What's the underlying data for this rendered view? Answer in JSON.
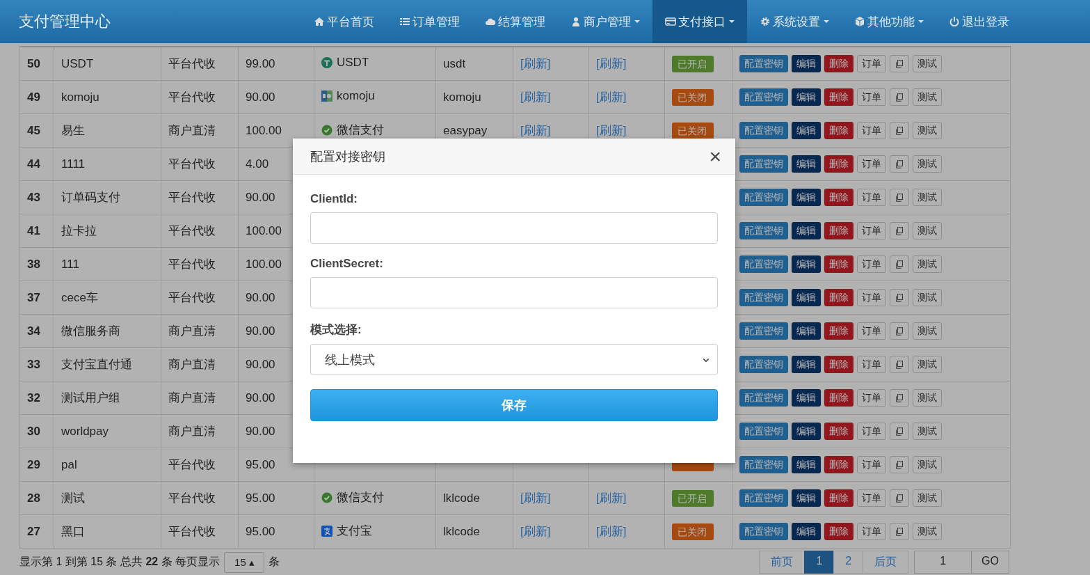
{
  "navbar": {
    "brand": "支付管理中心",
    "items": [
      {
        "kind": "home",
        "label": "平台首页",
        "dropdown": false,
        "selected": false
      },
      {
        "kind": "list",
        "label": "订单管理",
        "dropdown": false,
        "selected": false
      },
      {
        "kind": "cloud",
        "label": "结算管理",
        "dropdown": false,
        "selected": false
      },
      {
        "kind": "user",
        "label": "商户管理",
        "dropdown": true,
        "selected": false
      },
      {
        "kind": "card",
        "label": "支付接口",
        "dropdown": true,
        "selected": true
      },
      {
        "kind": "gear",
        "label": "系统设置",
        "dropdown": true,
        "selected": false
      },
      {
        "kind": "cube",
        "label": "其他功能",
        "dropdown": true,
        "selected": false
      },
      {
        "kind": "power",
        "label": "退出登录",
        "dropdown": false,
        "selected": false
      }
    ]
  },
  "table": {
    "rows": [
      {
        "id": "50",
        "name": "USDT",
        "type": "平台代收",
        "rate": "99.00",
        "channel": {
          "kind": "usdt",
          "label": "USDT"
        },
        "code": "usdt",
        "links": [
          "[刷新]",
          "[刷新]"
        ],
        "status": {
          "on": true,
          "label": "已开启"
        },
        "actions": [
          {
            "kind": "primary",
            "label": "配置密钥"
          },
          {
            "kind": "navy",
            "label": "编辑"
          },
          {
            "kind": "danger",
            "label": "删除"
          },
          {
            "kind": "default",
            "label": "订单"
          },
          {
            "kind": "copy"
          },
          {
            "kind": "default",
            "label": "测试"
          }
        ]
      },
      {
        "id": "49",
        "name": "komoju",
        "type": "平台代收",
        "rate": "90.00",
        "channel": {
          "kind": "komoju",
          "label": "komoju"
        },
        "code": "komoju",
        "links": [
          "[刷新]",
          "[刷新]"
        ],
        "status": {
          "on": false,
          "label": "已关闭"
        },
        "actions": [
          {
            "kind": "primary",
            "label": "配置密钥"
          },
          {
            "kind": "navy",
            "label": "编辑"
          },
          {
            "kind": "danger",
            "label": "删除"
          },
          {
            "kind": "default",
            "label": "订单"
          },
          {
            "kind": "copy"
          },
          {
            "kind": "default",
            "label": "测试"
          }
        ]
      },
      {
        "id": "45",
        "name": "易生",
        "type": "商户直清",
        "rate": "100.00",
        "channel": {
          "kind": "wechat",
          "label": "微信支付"
        },
        "code": "easypay",
        "links": [
          "[刷新]",
          "[刷新]"
        ],
        "status": {
          "on": false,
          "label": "已关闭"
        },
        "actions": [
          {
            "kind": "primary",
            "label": "配置密钥"
          },
          {
            "kind": "navy",
            "label": "编辑"
          },
          {
            "kind": "danger",
            "label": "删除"
          },
          {
            "kind": "default",
            "label": "订单"
          },
          {
            "kind": "copy"
          },
          {
            "kind": "default",
            "label": "测试"
          }
        ]
      },
      {
        "id": "44",
        "name": "1111",
        "type": "平台代收",
        "rate": "4.00",
        "actions": [
          {
            "kind": "primary",
            "label": "配置密钥"
          },
          {
            "kind": "navy",
            "label": "编辑"
          },
          {
            "kind": "danger",
            "label": "删除"
          },
          {
            "kind": "default",
            "label": "订单"
          },
          {
            "kind": "copy"
          },
          {
            "kind": "default",
            "label": "测试"
          }
        ]
      },
      {
        "id": "43",
        "name": "订单码支付",
        "type": "平台代收",
        "rate": "90.00",
        "actions": [
          {
            "kind": "primary",
            "label": "配置密钥"
          },
          {
            "kind": "navy",
            "label": "编辑"
          },
          {
            "kind": "danger",
            "label": "删除"
          },
          {
            "kind": "default",
            "label": "订单"
          },
          {
            "kind": "copy"
          },
          {
            "kind": "default",
            "label": "测试"
          }
        ]
      },
      {
        "id": "41",
        "name": "拉卡拉",
        "type": "平台代收",
        "rate": "100.00",
        "actions": [
          {
            "kind": "primary",
            "label": "配置密钥"
          },
          {
            "kind": "navy",
            "label": "编辑"
          },
          {
            "kind": "danger",
            "label": "删除"
          },
          {
            "kind": "default",
            "label": "订单"
          },
          {
            "kind": "copy"
          },
          {
            "kind": "default",
            "label": "测试"
          }
        ]
      },
      {
        "id": "38",
        "name": "111",
        "type": "平台代收",
        "rate": "100.00",
        "actions": [
          {
            "kind": "primary",
            "label": "配置密钥"
          },
          {
            "kind": "navy",
            "label": "编辑"
          },
          {
            "kind": "danger",
            "label": "删除"
          },
          {
            "kind": "default",
            "label": "订单"
          },
          {
            "kind": "copy"
          },
          {
            "kind": "default",
            "label": "测试"
          }
        ]
      },
      {
        "id": "37",
        "name": "cece车",
        "type": "平台代收",
        "rate": "90.00",
        "actions": [
          {
            "kind": "primary",
            "label": "配置密钥"
          },
          {
            "kind": "navy",
            "label": "编辑"
          },
          {
            "kind": "danger",
            "label": "删除"
          },
          {
            "kind": "default",
            "label": "订单"
          },
          {
            "kind": "copy"
          },
          {
            "kind": "default",
            "label": "测试"
          }
        ]
      },
      {
        "id": "34",
        "name": "微信服务商",
        "type": "商户直清",
        "rate": "90.00",
        "actions": [
          {
            "kind": "primary",
            "label": "配置密钥"
          },
          {
            "kind": "navy",
            "label": "编辑"
          },
          {
            "kind": "danger",
            "label": "删除"
          },
          {
            "kind": "default",
            "label": "订单"
          },
          {
            "kind": "copy"
          },
          {
            "kind": "default",
            "label": "测试"
          }
        ]
      },
      {
        "id": "33",
        "name": "支付宝直付通",
        "type": "商户直清",
        "rate": "90.00",
        "actions": [
          {
            "kind": "primary",
            "label": "配置密钥"
          },
          {
            "kind": "navy",
            "label": "编辑"
          },
          {
            "kind": "danger",
            "label": "删除"
          },
          {
            "kind": "default",
            "label": "订单"
          },
          {
            "kind": "copy"
          },
          {
            "kind": "default",
            "label": "测试"
          }
        ]
      },
      {
        "id": "32",
        "name": "测试用户组",
        "type": "商户直清",
        "rate": "90.00",
        "actions": [
          {
            "kind": "primary",
            "label": "配置密钥"
          },
          {
            "kind": "navy",
            "label": "编辑"
          },
          {
            "kind": "danger",
            "label": "删除"
          },
          {
            "kind": "default",
            "label": "订单"
          },
          {
            "kind": "copy"
          },
          {
            "kind": "default",
            "label": "测试"
          }
        ]
      },
      {
        "id": "30",
        "name": "worldpay",
        "type": "商户直清",
        "rate": "90.00",
        "actions": [
          {
            "kind": "primary",
            "label": "配置密钥"
          },
          {
            "kind": "navy",
            "label": "编辑"
          },
          {
            "kind": "danger",
            "label": "删除"
          },
          {
            "kind": "default",
            "label": "订单"
          },
          {
            "kind": "copy"
          },
          {
            "kind": "default",
            "label": "测试"
          }
        ]
      },
      {
        "id": "29",
        "name": "pal",
        "type": "平台代收",
        "rate": "95.00",
        "status": {
          "on": false
        },
        "actions": [
          {
            "kind": "primary",
            "label": "配置密钥"
          },
          {
            "kind": "navy",
            "label": "编辑"
          },
          {
            "kind": "danger",
            "label": "删除"
          },
          {
            "kind": "default",
            "label": "订单"
          },
          {
            "kind": "copy"
          },
          {
            "kind": "default",
            "label": "测试"
          }
        ]
      },
      {
        "id": "28",
        "name": "测试",
        "type": "平台代收",
        "rate": "95.00",
        "channel": {
          "kind": "wechat",
          "label": "微信支付"
        },
        "code": "lklcode",
        "links": [
          "[刷新]",
          "[刷新]"
        ],
        "status": {
          "on": true,
          "label": "已开启"
        },
        "actions": [
          {
            "kind": "primary",
            "label": "配置密钥"
          },
          {
            "kind": "navy",
            "label": "编辑"
          },
          {
            "kind": "danger",
            "label": "删除"
          },
          {
            "kind": "default",
            "label": "订单"
          },
          {
            "kind": "copy"
          },
          {
            "kind": "default",
            "label": "测试"
          }
        ]
      },
      {
        "id": "27",
        "name": "黑口",
        "type": "平台代收",
        "rate": "95.00",
        "channel": {
          "kind": "alipay",
          "label": "支付宝"
        },
        "code": "lklcode",
        "links": [
          "[刷新]",
          "[刷新]"
        ],
        "status": {
          "on": false,
          "label": "已关闭"
        },
        "actions": [
          {
            "kind": "primary",
            "label": "配置密钥"
          },
          {
            "kind": "navy",
            "label": "编辑"
          },
          {
            "kind": "danger",
            "label": "删除"
          },
          {
            "kind": "default",
            "label": "订单"
          },
          {
            "kind": "copy"
          },
          {
            "kind": "default",
            "label": "测试"
          }
        ]
      }
    ]
  },
  "footer": {
    "info_start": "显示第 1 到第 15 条 总共 ",
    "total": "22",
    "info_end": " 条  每页显示",
    "page_size": "15 ▴",
    "unit": "条",
    "pages": [
      {
        "label": "前页",
        "selected": false
      },
      {
        "label": "1",
        "selected": true
      },
      {
        "label": "2",
        "selected": false
      },
      {
        "label": "后页",
        "selected": false
      }
    ],
    "jump": "1",
    "go": "GO"
  },
  "modal": {
    "title": "配置对接密钥",
    "close": "×",
    "fields": [
      {
        "kind": "input",
        "label": "ClientId:"
      },
      {
        "kind": "input",
        "label": "ClientSecret:"
      },
      {
        "kind": "select",
        "label": "模式选择:",
        "value": "线上模式"
      }
    ],
    "submit": "保存"
  }
}
